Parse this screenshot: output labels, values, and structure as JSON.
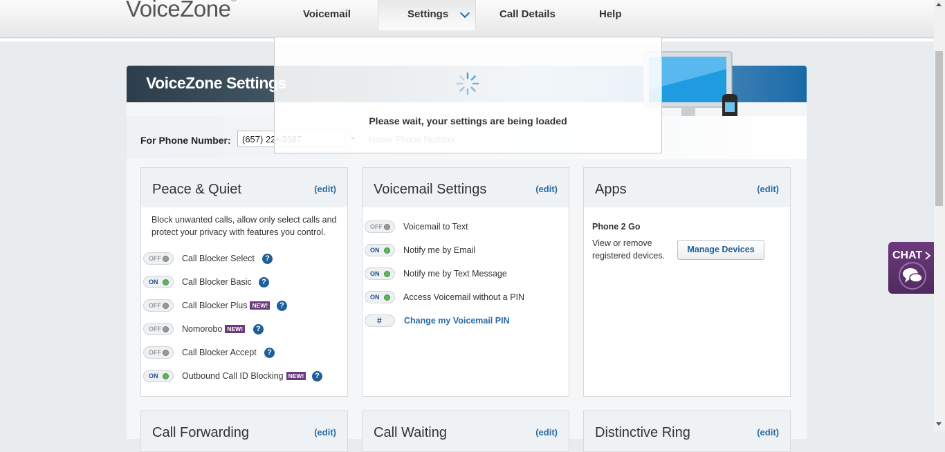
{
  "header": {
    "logo": "VoiceZone",
    "logo_mark": "®",
    "nav": [
      "Voicemail",
      "Settings",
      "Call Details",
      "Help"
    ],
    "active_nav": "Settings"
  },
  "page": {
    "title": "VoiceZone Settings",
    "phone_label": "For Phone Number:",
    "phone_value": "(657) 22•-3387",
    "name_placeholder": "Name Phone Number"
  },
  "cards": {
    "peace": {
      "title": "Peace & Quiet",
      "edit": "(edit)",
      "description": "Block unwanted calls, allow only select calls and protect your privacy with features you control.",
      "items": [
        {
          "label": "Call Blocker Select",
          "state": "OFF",
          "new": ""
        },
        {
          "label": "Call Blocker Basic",
          "state": "ON",
          "new": ""
        },
        {
          "label": "Call Blocker Plus",
          "state": "OFF",
          "new": "NEW!"
        },
        {
          "label": "Nomorobo",
          "state": "OFF",
          "new": "NEW!"
        },
        {
          "label": "Call Blocker Accept",
          "state": "OFF",
          "new": ""
        },
        {
          "label": "Outbound Call ID Blocking",
          "state": "ON",
          "new": "NEW!"
        }
      ]
    },
    "voicemail": {
      "title": "Voicemail Settings",
      "edit": "(edit)",
      "items": [
        {
          "label": "Voicemail to Text",
          "state": "OFF"
        },
        {
          "label": "Notify me by Email",
          "state": "ON"
        },
        {
          "label": "Notify me by Text Message",
          "state": "ON"
        },
        {
          "label": "Access Voicemail without a PIN",
          "state": "ON"
        }
      ],
      "pin_symbol": "#",
      "pin_label": "Change my Voicemail PIN"
    },
    "apps": {
      "title": "Apps",
      "edit": "(edit)",
      "app_name": "Phone 2 Go",
      "app_desc": "View or remove registered devices.",
      "button": "Manage Devices"
    },
    "bottom": [
      {
        "title": "Call Forwarding",
        "edit": "(edit)"
      },
      {
        "title": "Call Waiting",
        "edit": "(edit)"
      },
      {
        "title": "Distinctive Ring",
        "edit": "(edit)"
      }
    ]
  },
  "modal": {
    "message": "Please wait, your settings are being loaded"
  },
  "chat": {
    "label": "CHAT"
  },
  "help_symbol": "?",
  "colors": {
    "accent": "#2a6aa3",
    "chat": "#5c2f6c",
    "on_dot": "#5cb85c",
    "new_badge": "#6c3b7e"
  }
}
